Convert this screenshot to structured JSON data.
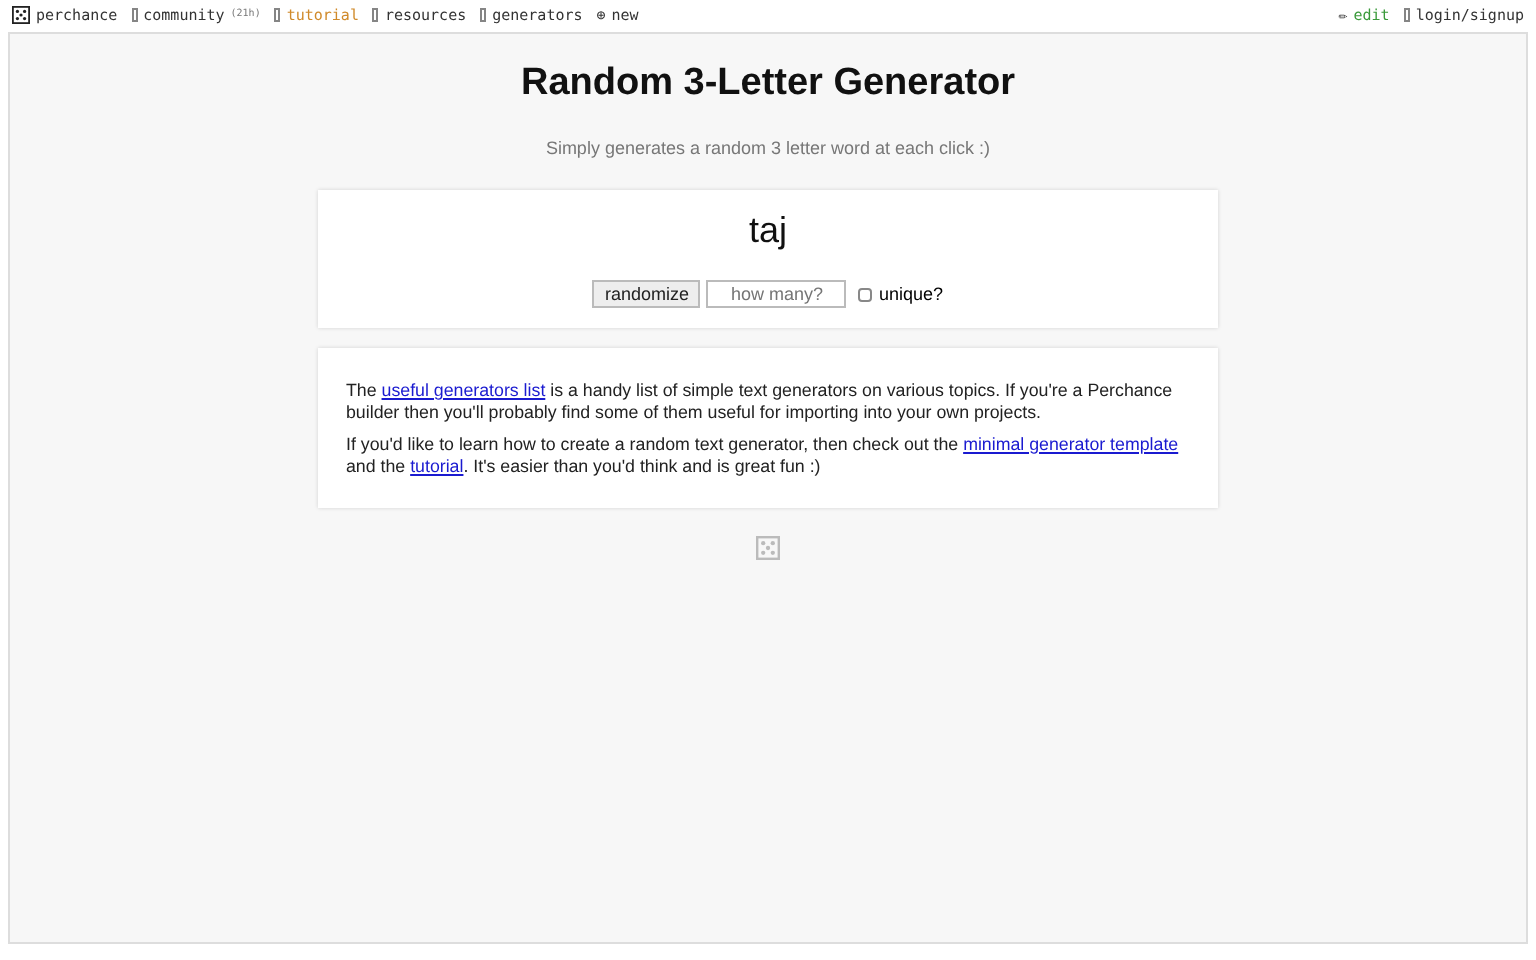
{
  "nav": {
    "left": [
      {
        "kind": "logo",
        "label": "perchance",
        "selected": false
      },
      {
        "kind": "box",
        "label": "community",
        "badge": "(21h)",
        "selected": false
      },
      {
        "kind": "box",
        "label": "tutorial",
        "selected": true
      },
      {
        "kind": "box",
        "label": "resources",
        "selected": false
      },
      {
        "kind": "box",
        "label": "generators",
        "selected": false
      },
      {
        "kind": "plus",
        "glyph": "⊕",
        "label": "new",
        "selected": false
      }
    ],
    "right": [
      {
        "kind": "edit",
        "glyph": "✏",
        "label": "edit"
      },
      {
        "kind": "box",
        "label": "login/signup"
      }
    ]
  },
  "title": "Random 3-Letter Generator",
  "subtitle": "Simply generates a random 3 letter word at each click :)",
  "output": "taj",
  "controls": {
    "button": "randomize",
    "count_placeholder": "how many?",
    "unique_label": "unique?",
    "unique_checked": false
  },
  "info": [
    [
      {
        "kind": "text",
        "text": "The "
      },
      {
        "kind": "link",
        "text": "useful generators list"
      },
      {
        "kind": "text",
        "text": " is a handy list of simple text generators on various topics. If you're a Perchance builder then you'll probably find some of them useful for importing into your own projects."
      }
    ],
    [
      {
        "kind": "text",
        "text": "If you'd like to learn how to create a random text generator, then check out the "
      },
      {
        "kind": "link",
        "text": "minimal generator template"
      },
      {
        "kind": "text",
        "text": " and the "
      },
      {
        "kind": "link",
        "text": "tutorial"
      },
      {
        "kind": "text",
        "text": ". It's easier than you'd think and is great fun :)"
      }
    ]
  ]
}
